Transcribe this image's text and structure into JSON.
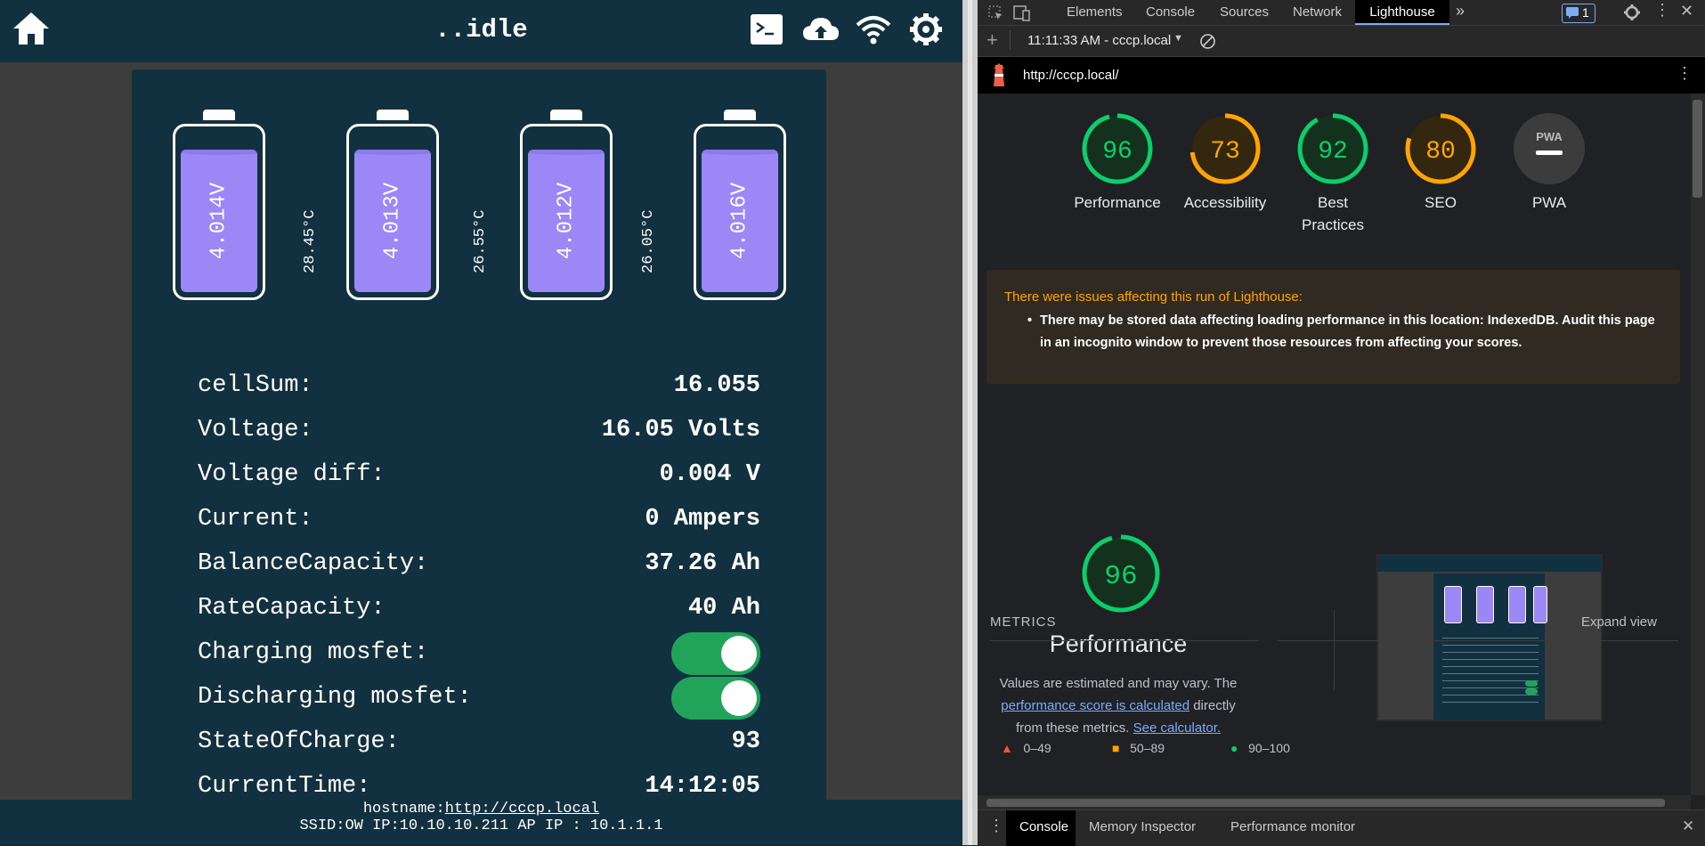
{
  "app": {
    "title": "..idle",
    "icons": [
      "home-icon",
      "terminal-icon",
      "cloud-upload-icon",
      "wifi-icon",
      "settings-gear-icon"
    ],
    "cells": [
      {
        "voltage": "4.014V"
      },
      {
        "voltage": "4.013V"
      },
      {
        "voltage": "4.012V"
      },
      {
        "voltage": "4.016V"
      }
    ],
    "temps": [
      "28.45°C",
      "26.55°C",
      "26.05°C"
    ],
    "stats": [
      {
        "label": "cellSum:",
        "value": "16.055"
      },
      {
        "label": "Voltage:",
        "value": "16.05 Volts"
      },
      {
        "label": "Voltage diff:",
        "value": "0.004 V"
      },
      {
        "label": "Current:",
        "value": "0 Ampers"
      },
      {
        "label": "BalanceCapacity:",
        "value": "37.26 Ah"
      },
      {
        "label": "RateCapacity:",
        "value": "40 Ah"
      },
      {
        "label": "Charging mosfet:",
        "value": "on"
      },
      {
        "label": "Discharging mosfet:",
        "value": "on"
      },
      {
        "label": "StateOfCharge:",
        "value": "93"
      },
      {
        "label": "CurrentTime:",
        "value": "14:12:05"
      }
    ],
    "footer": {
      "hostname_label": "hostname:",
      "hostname_link": "http://cccp.local",
      "network": "SSID:OW IP:10.10.10.211 AP IP : 10.1.1.1"
    }
  },
  "devtools": {
    "tabs": [
      "Elements",
      "Console",
      "Sources",
      "Network",
      "Lighthouse"
    ],
    "active_tab": "Lighthouse",
    "more_tabs": "»",
    "issues_count": "1",
    "report_selector": "11:11:33 AM - cccp.local",
    "report_url": "http://cccp.local/",
    "scores": [
      {
        "label": "Performance",
        "score": 96,
        "color": "#0cce6b"
      },
      {
        "label": "Accessibility",
        "score": 73,
        "color": "#ffa400"
      },
      {
        "label": "Best Practices",
        "score": 92,
        "color": "#0cce6b"
      },
      {
        "label": "SEO",
        "score": 80,
        "color": "#ffa400"
      },
      {
        "label": "PWA",
        "score": null,
        "color": "#9e9e9e"
      }
    ],
    "pwa_badge": "PWA",
    "warning": {
      "title": "There were issues affecting this run of Lighthouse:",
      "item": "There may be stored data affecting loading performance in this location: IndexedDB. Audit this page in an incognito window to prevent those resources from affecting your scores."
    },
    "performance": {
      "score": "96",
      "title": "Performance",
      "desc_pre": "Values are estimated and may vary. The ",
      "desc_link1": "performance score is calculated",
      "desc_mid": " directly from these metrics. ",
      "desc_link2": "See calculator."
    },
    "legend": [
      "0–49",
      "50–89",
      "90–100"
    ],
    "metrics_label": "METRICS",
    "expand_view": "Expand view",
    "drawer_tabs": [
      "Console",
      "Memory Inspector",
      "Performance monitor"
    ]
  }
}
